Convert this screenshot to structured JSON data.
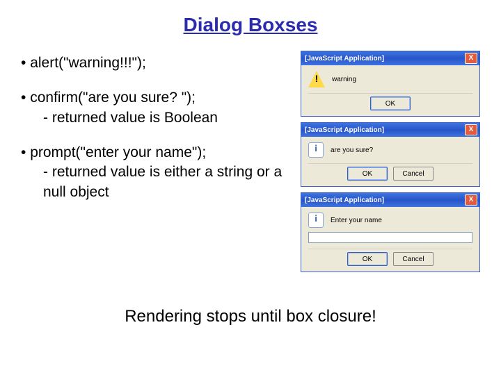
{
  "title": "Dialog Boxses",
  "bullets": {
    "b1": "alert(\"warning!!!\");",
    "b2": "confirm(\"are you sure? \");",
    "b2sub": "returned value is Boolean",
    "b3": "prompt(\"enter your name\");",
    "b3sub": "returned value is either a string or a null object"
  },
  "dialogs": {
    "titlebar": "[JavaScript Application]",
    "alert_msg": "warning",
    "confirm_msg": "are you sure?",
    "prompt_msg": "Enter your name",
    "ok": "OK",
    "cancel": "Cancel",
    "close": "X"
  },
  "bottom": "Rendering stops until box closure!"
}
